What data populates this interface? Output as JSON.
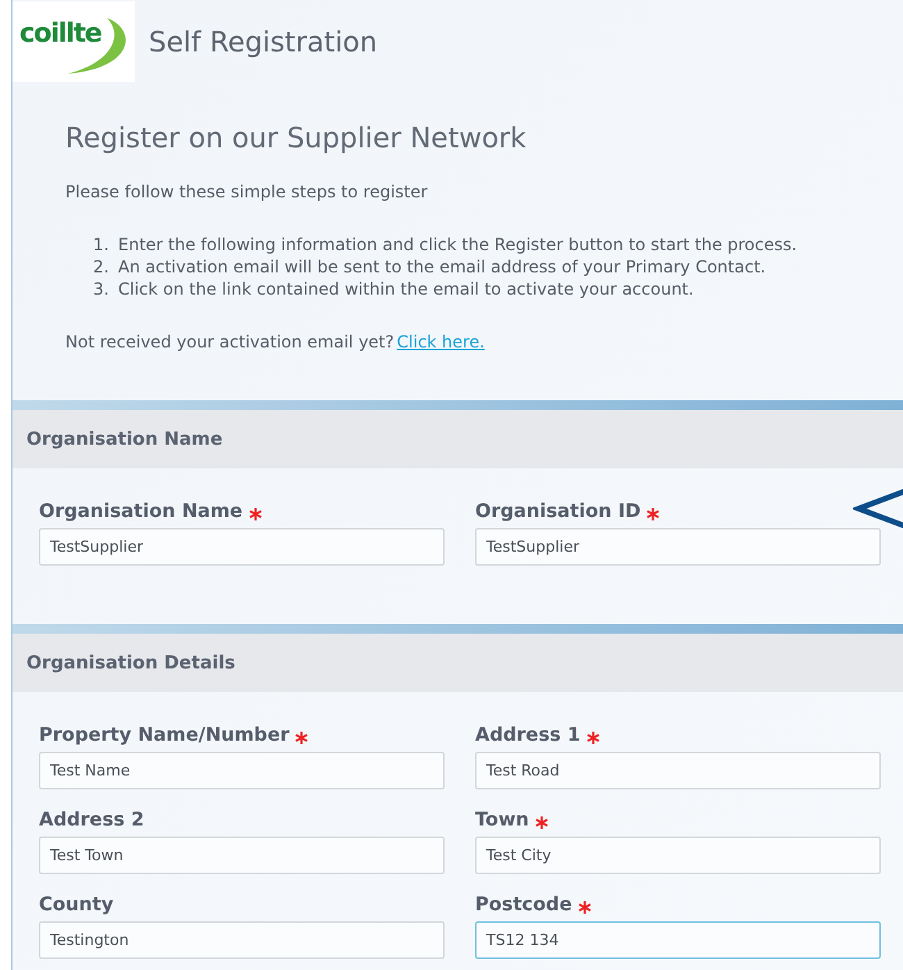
{
  "header": {
    "logo": "coillte",
    "title": "Self Registration"
  },
  "intro": {
    "heading": "Register on our Supplier Network",
    "lead": "Please follow these simple steps to register",
    "steps": [
      {
        "number": "1.",
        "text": "Enter the following information and click the Register button to start the process."
      },
      {
        "number": "2.",
        "text": "An activation email will be sent to the email address of your Primary Contact."
      },
      {
        "number": "3.",
        "text": "Click on the link contained within the email to activate your account."
      }
    ],
    "resend": {
      "text": "Not received your activation email yet?",
      "link": "Click here."
    }
  },
  "sections": [
    {
      "title": "Organisation Name",
      "fields": [
        {
          "label": "Organisation Name",
          "required": true,
          "value": "TestSupplier",
          "focused": false
        },
        {
          "label": "Organisation ID",
          "required": true,
          "value": "TestSupplier",
          "focused": false
        }
      ]
    },
    {
      "title": "Organisation Details",
      "fields": [
        {
          "label": "Property Name/Number",
          "required": true,
          "value": "Test Name",
          "focused": false
        },
        {
          "label": "Address 1",
          "required": true,
          "value": "Test Road",
          "focused": false
        },
        {
          "label": "Address 2",
          "required": false,
          "value": "Test Town",
          "focused": false
        },
        {
          "label": "Town",
          "required": true,
          "value": "Test City",
          "focused": false
        },
        {
          "label": "County",
          "required": false,
          "value": "Testington",
          "focused": false
        },
        {
          "label": "Postcode",
          "required": true,
          "value": "TS12 134",
          "focused": true
        }
      ]
    }
  ]
}
